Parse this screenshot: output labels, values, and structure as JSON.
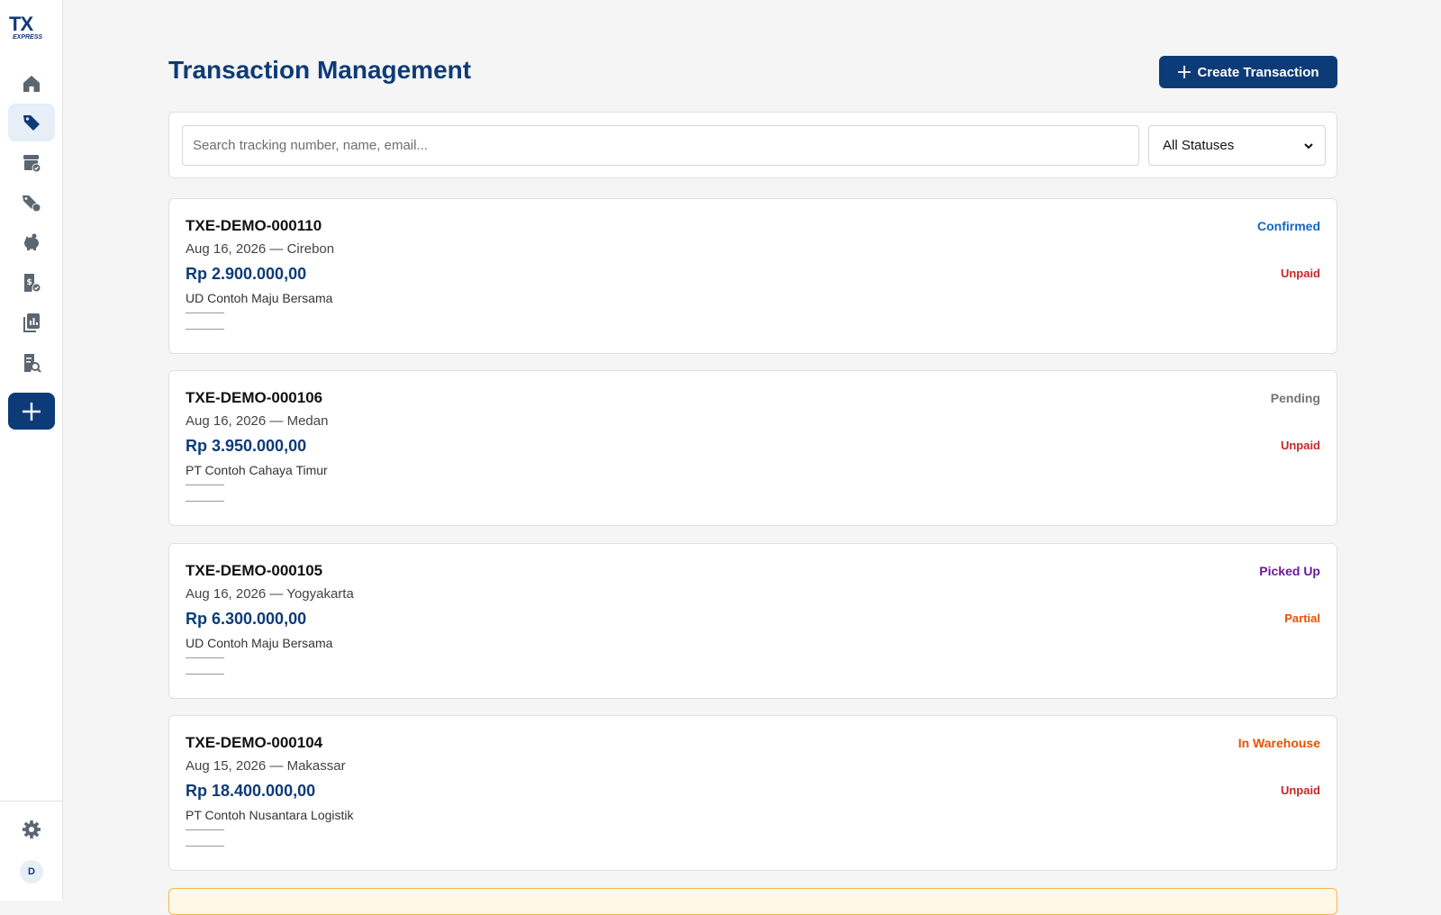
{
  "app": {
    "logo_text": "TX",
    "logo_sub": "EXPRESS",
    "user_initial": "D"
  },
  "sidebar": {
    "items": [
      {
        "icon": "home-icon",
        "active": false
      },
      {
        "icon": "tag-icon",
        "active": true
      },
      {
        "icon": "warehouse-check-icon",
        "active": false
      },
      {
        "icon": "tags-discount-icon",
        "active": false
      },
      {
        "icon": "piggy-bank-icon",
        "active": false
      },
      {
        "icon": "invoice-check-icon",
        "active": false
      },
      {
        "icon": "reports-icon",
        "active": false
      },
      {
        "icon": "audit-search-icon",
        "active": false
      }
    ],
    "add_icon": "plus-icon",
    "settings_icon": "gear-icon"
  },
  "header": {
    "title": "Transaction Management",
    "create_label": "Create Transaction"
  },
  "filters": {
    "search_placeholder": "Search tracking number, name, email...",
    "status_selected": "All Statuses"
  },
  "colors": {
    "brand": "#0d3b78",
    "confirmed": "#1565c0",
    "pending": "#757575",
    "picked_up": "#6a1b9a",
    "in_warehouse": "#e65100",
    "unpaid": "#c62828",
    "partial": "#e65100"
  },
  "transactions": [
    {
      "tracking": "TXE-DEMO-000110",
      "meta": "Aug 16, 2026 — Cirebon",
      "amount": "Rp 2.900.000,00",
      "company": "UD Contoh Maju Bersama",
      "status": "Confirmed",
      "status_color": "#1565c0",
      "payment": "Unpaid",
      "payment_color": "#c62828"
    },
    {
      "tracking": "TXE-DEMO-000106",
      "meta": "Aug 16, 2026 — Medan",
      "amount": "Rp 3.950.000,00",
      "company": "PT Contoh Cahaya Timur",
      "status": "Pending",
      "status_color": "#757575",
      "payment": "Unpaid",
      "payment_color": "#c62828"
    },
    {
      "tracking": "TXE-DEMO-000105",
      "meta": "Aug 16, 2026 — Yogyakarta",
      "amount": "Rp 6.300.000,00",
      "company": "UD Contoh Maju Bersama",
      "status": "Picked Up",
      "status_color": "#6a1b9a",
      "payment": "Partial",
      "payment_color": "#e65100"
    },
    {
      "tracking": "TXE-DEMO-000104",
      "meta": "Aug 15, 2026 — Makassar",
      "amount": "Rp 18.400.000,00",
      "company": "PT Contoh Nusantara Logistik",
      "status": "In Warehouse",
      "status_color": "#e65100",
      "payment": "Unpaid",
      "payment_color": "#c62828"
    }
  ]
}
